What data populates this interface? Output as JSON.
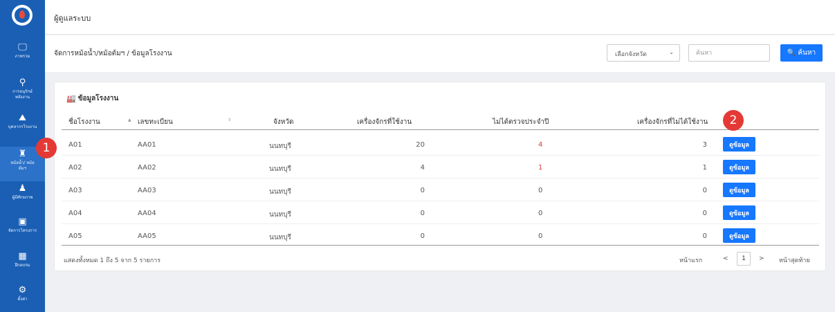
{
  "app": {
    "title": "ผู้ดูแลระบบ"
  },
  "sidebar": {
    "items": [
      {
        "icon": "monitor-icon",
        "label": "ภาพรวม"
      },
      {
        "icon": "bulb-icon",
        "label": "การอนุรักษ์ พลังงาน"
      },
      {
        "icon": "people-icon",
        "label": "บุคลากรโรงงาน"
      },
      {
        "icon": "boiler-icon",
        "label": "หม้อน้ำ/ หม้อต้มฯ"
      },
      {
        "icon": "person-icon",
        "label": "ผู้มีศักยภาพ"
      },
      {
        "icon": "clipboard-icon",
        "label": "จัดการโครงการ"
      },
      {
        "icon": "training-icon",
        "label": "ฝึกอบรม"
      },
      {
        "icon": "gear-icon",
        "label": "ตั้งค่า"
      }
    ]
  },
  "breadcrumb": "จัดการหม้อน้ำ/หม้อต้มฯ / ข้อมูลโรงงาน",
  "filters": {
    "province_select": "เลือกจังหวัด",
    "search_placeholder": "ค้นหา",
    "search_button": "ค้นหา"
  },
  "card": {
    "title": "ข้อมูลโรงงาน",
    "columns": [
      "ชื่อโรงงาน",
      "เลขทะเบียน",
      "จังหวัด",
      "เครื่องจักรที่ใช้งาน",
      "ไม่ได้ตรวจประจำปี",
      "เครื่องจักรที่ไม่ได้ใช้งาน"
    ],
    "rows": [
      {
        "name": "A01",
        "reg": "AA01",
        "province": "นนทบุรี",
        "active": "20",
        "not_inspected": "4",
        "inactive": "3",
        "action": "ดูข้อมูล"
      },
      {
        "name": "A02",
        "reg": "AA02",
        "province": "นนทบุรี",
        "active": "4",
        "not_inspected": "1",
        "inactive": "1",
        "action": "ดูข้อมูล"
      },
      {
        "name": "A03",
        "reg": "AA03",
        "province": "นนทบุรี",
        "active": "0",
        "not_inspected": "0",
        "inactive": "0",
        "action": "ดูข้อมูล"
      },
      {
        "name": "A04",
        "reg": "AA04",
        "province": "นนทบุรี",
        "active": "0",
        "not_inspected": "0",
        "inactive": "0",
        "action": "ดูข้อมูล"
      },
      {
        "name": "A05",
        "reg": "AA05",
        "province": "นนทบุรี",
        "active": "0",
        "not_inspected": "0",
        "inactive": "0",
        "action": "ดูข้อมูล"
      }
    ],
    "summary": "แสดงทั้งหมด 1 ถึง 5 จาก 5 รายการ",
    "pager": {
      "first": "หน้าแรก",
      "prev": "<",
      "page": "1",
      "next": ">",
      "last": "หน้าสุดท้าย"
    }
  },
  "badges": {
    "one": "1",
    "two": "2"
  },
  "colors": {
    "primary": "#1677ff",
    "sidebar": "#1a5fb4",
    "alert": "#e53935"
  }
}
